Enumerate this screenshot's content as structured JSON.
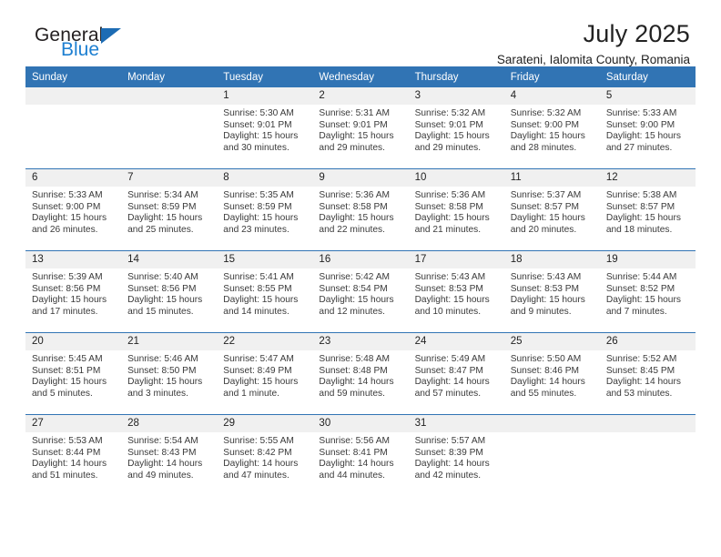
{
  "logo": {
    "word_one": "General",
    "word_two": "Blue",
    "triangle_icon": "triangle-icon",
    "brand_blue": "#1d7fd1"
  },
  "header": {
    "title": "July 2025",
    "subtitle": "Sarateni, Ialomita County, Romania",
    "header_bg": "#3174b4",
    "daynum_bg": "#f0f0f0"
  },
  "weekday_headers": [
    "Sunday",
    "Monday",
    "Tuesday",
    "Wednesday",
    "Thursday",
    "Friday",
    "Saturday"
  ],
  "weeks": [
    [
      {
        "day": "",
        "empty": true,
        "sunrise": "",
        "sunset": "",
        "daylight_line1": "",
        "daylight_line2": ""
      },
      {
        "day": "",
        "empty": true,
        "sunrise": "",
        "sunset": "",
        "daylight_line1": "",
        "daylight_line2": ""
      },
      {
        "day": "1",
        "sunrise": "Sunrise: 5:30 AM",
        "sunset": "Sunset: 9:01 PM",
        "daylight_line1": "Daylight: 15 hours",
        "daylight_line2": "and 30 minutes."
      },
      {
        "day": "2",
        "sunrise": "Sunrise: 5:31 AM",
        "sunset": "Sunset: 9:01 PM",
        "daylight_line1": "Daylight: 15 hours",
        "daylight_line2": "and 29 minutes."
      },
      {
        "day": "3",
        "sunrise": "Sunrise: 5:32 AM",
        "sunset": "Sunset: 9:01 PM",
        "daylight_line1": "Daylight: 15 hours",
        "daylight_line2": "and 29 minutes."
      },
      {
        "day": "4",
        "sunrise": "Sunrise: 5:32 AM",
        "sunset": "Sunset: 9:00 PM",
        "daylight_line1": "Daylight: 15 hours",
        "daylight_line2": "and 28 minutes."
      },
      {
        "day": "5",
        "sunrise": "Sunrise: 5:33 AM",
        "sunset": "Sunset: 9:00 PM",
        "daylight_line1": "Daylight: 15 hours",
        "daylight_line2": "and 27 minutes."
      }
    ],
    [
      {
        "day": "6",
        "sunrise": "Sunrise: 5:33 AM",
        "sunset": "Sunset: 9:00 PM",
        "daylight_line1": "Daylight: 15 hours",
        "daylight_line2": "and 26 minutes."
      },
      {
        "day": "7",
        "sunrise": "Sunrise: 5:34 AM",
        "sunset": "Sunset: 8:59 PM",
        "daylight_line1": "Daylight: 15 hours",
        "daylight_line2": "and 25 minutes."
      },
      {
        "day": "8",
        "sunrise": "Sunrise: 5:35 AM",
        "sunset": "Sunset: 8:59 PM",
        "daylight_line1": "Daylight: 15 hours",
        "daylight_line2": "and 23 minutes."
      },
      {
        "day": "9",
        "sunrise": "Sunrise: 5:36 AM",
        "sunset": "Sunset: 8:58 PM",
        "daylight_line1": "Daylight: 15 hours",
        "daylight_line2": "and 22 minutes."
      },
      {
        "day": "10",
        "sunrise": "Sunrise: 5:36 AM",
        "sunset": "Sunset: 8:58 PM",
        "daylight_line1": "Daylight: 15 hours",
        "daylight_line2": "and 21 minutes."
      },
      {
        "day": "11",
        "sunrise": "Sunrise: 5:37 AM",
        "sunset": "Sunset: 8:57 PM",
        "daylight_line1": "Daylight: 15 hours",
        "daylight_line2": "and 20 minutes."
      },
      {
        "day": "12",
        "sunrise": "Sunrise: 5:38 AM",
        "sunset": "Sunset: 8:57 PM",
        "daylight_line1": "Daylight: 15 hours",
        "daylight_line2": "and 18 minutes."
      }
    ],
    [
      {
        "day": "13",
        "sunrise": "Sunrise: 5:39 AM",
        "sunset": "Sunset: 8:56 PM",
        "daylight_line1": "Daylight: 15 hours",
        "daylight_line2": "and 17 minutes."
      },
      {
        "day": "14",
        "sunrise": "Sunrise: 5:40 AM",
        "sunset": "Sunset: 8:56 PM",
        "daylight_line1": "Daylight: 15 hours",
        "daylight_line2": "and 15 minutes."
      },
      {
        "day": "15",
        "sunrise": "Sunrise: 5:41 AM",
        "sunset": "Sunset: 8:55 PM",
        "daylight_line1": "Daylight: 15 hours",
        "daylight_line2": "and 14 minutes."
      },
      {
        "day": "16",
        "sunrise": "Sunrise: 5:42 AM",
        "sunset": "Sunset: 8:54 PM",
        "daylight_line1": "Daylight: 15 hours",
        "daylight_line2": "and 12 minutes."
      },
      {
        "day": "17",
        "sunrise": "Sunrise: 5:43 AM",
        "sunset": "Sunset: 8:53 PM",
        "daylight_line1": "Daylight: 15 hours",
        "daylight_line2": "and 10 minutes."
      },
      {
        "day": "18",
        "sunrise": "Sunrise: 5:43 AM",
        "sunset": "Sunset: 8:53 PM",
        "daylight_line1": "Daylight: 15 hours",
        "daylight_line2": "and 9 minutes."
      },
      {
        "day": "19",
        "sunrise": "Sunrise: 5:44 AM",
        "sunset": "Sunset: 8:52 PM",
        "daylight_line1": "Daylight: 15 hours",
        "daylight_line2": "and 7 minutes."
      }
    ],
    [
      {
        "day": "20",
        "sunrise": "Sunrise: 5:45 AM",
        "sunset": "Sunset: 8:51 PM",
        "daylight_line1": "Daylight: 15 hours",
        "daylight_line2": "and 5 minutes."
      },
      {
        "day": "21",
        "sunrise": "Sunrise: 5:46 AM",
        "sunset": "Sunset: 8:50 PM",
        "daylight_line1": "Daylight: 15 hours",
        "daylight_line2": "and 3 minutes."
      },
      {
        "day": "22",
        "sunrise": "Sunrise: 5:47 AM",
        "sunset": "Sunset: 8:49 PM",
        "daylight_line1": "Daylight: 15 hours",
        "daylight_line2": "and 1 minute."
      },
      {
        "day": "23",
        "sunrise": "Sunrise: 5:48 AM",
        "sunset": "Sunset: 8:48 PM",
        "daylight_line1": "Daylight: 14 hours",
        "daylight_line2": "and 59 minutes."
      },
      {
        "day": "24",
        "sunrise": "Sunrise: 5:49 AM",
        "sunset": "Sunset: 8:47 PM",
        "daylight_line1": "Daylight: 14 hours",
        "daylight_line2": "and 57 minutes."
      },
      {
        "day": "25",
        "sunrise": "Sunrise: 5:50 AM",
        "sunset": "Sunset: 8:46 PM",
        "daylight_line1": "Daylight: 14 hours",
        "daylight_line2": "and 55 minutes."
      },
      {
        "day": "26",
        "sunrise": "Sunrise: 5:52 AM",
        "sunset": "Sunset: 8:45 PM",
        "daylight_line1": "Daylight: 14 hours",
        "daylight_line2": "and 53 minutes."
      }
    ],
    [
      {
        "day": "27",
        "sunrise": "Sunrise: 5:53 AM",
        "sunset": "Sunset: 8:44 PM",
        "daylight_line1": "Daylight: 14 hours",
        "daylight_line2": "and 51 minutes."
      },
      {
        "day": "28",
        "sunrise": "Sunrise: 5:54 AM",
        "sunset": "Sunset: 8:43 PM",
        "daylight_line1": "Daylight: 14 hours",
        "daylight_line2": "and 49 minutes."
      },
      {
        "day": "29",
        "sunrise": "Sunrise: 5:55 AM",
        "sunset": "Sunset: 8:42 PM",
        "daylight_line1": "Daylight: 14 hours",
        "daylight_line2": "and 47 minutes."
      },
      {
        "day": "30",
        "sunrise": "Sunrise: 5:56 AM",
        "sunset": "Sunset: 8:41 PM",
        "daylight_line1": "Daylight: 14 hours",
        "daylight_line2": "and 44 minutes."
      },
      {
        "day": "31",
        "sunrise": "Sunrise: 5:57 AM",
        "sunset": "Sunset: 8:39 PM",
        "daylight_line1": "Daylight: 14 hours",
        "daylight_line2": "and 42 minutes."
      },
      {
        "day": "",
        "empty": true,
        "sunrise": "",
        "sunset": "",
        "daylight_line1": "",
        "daylight_line2": ""
      },
      {
        "day": "",
        "empty": true,
        "sunrise": "",
        "sunset": "",
        "daylight_line1": "",
        "daylight_line2": ""
      }
    ]
  ]
}
